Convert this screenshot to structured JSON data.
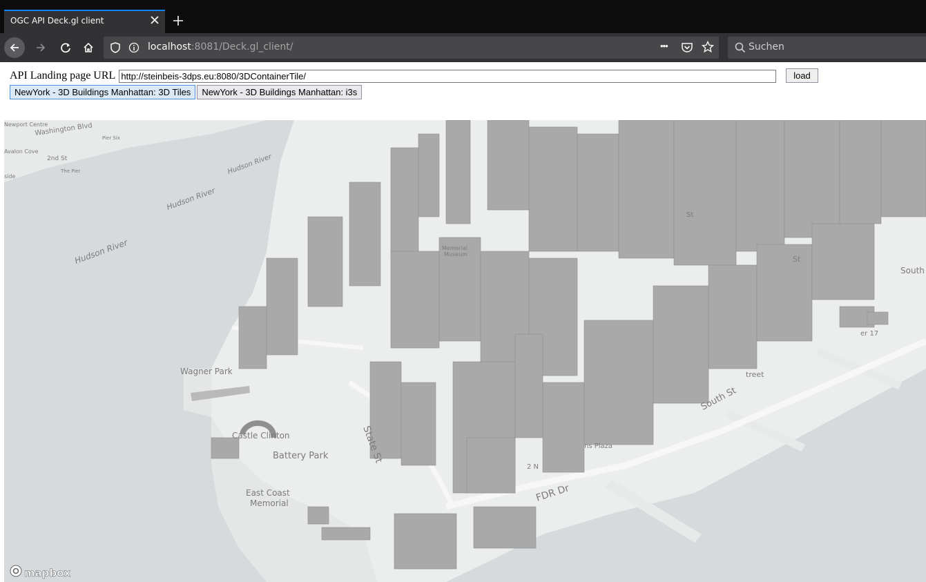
{
  "browser": {
    "tab_title": "OGC API Deck.gl client",
    "url_host": "localhost",
    "url_rest": ":8081/Deck.gl_client/",
    "search_placeholder": "Suchen",
    "page_actions": "•••"
  },
  "page": {
    "api_label": "API Landing page URL",
    "api_url_value": "http://steinbeis-3dps.eu:8080/3DContainerTile/",
    "load_label": "load",
    "datasets": [
      {
        "label": "NewYork - 3D Buildings Manhattan: 3D Tiles",
        "active": true
      },
      {
        "label": "NewYork - 3D Buildings Manhattan: i3s",
        "active": false
      }
    ]
  },
  "map": {
    "labels": {
      "newport": "Newport Centre",
      "washington": "Washington Blvd",
      "pier_six": "Pier Six",
      "avalon": "Avalon Cove",
      "second_st": "2nd St",
      "the_pier": "The Pier",
      "side": "side",
      "hudson1": "Hudson River",
      "hudson2": "Hudson River",
      "hudson3": "Hudson River",
      "wagner": "Wagner Park",
      "castle": "Castle Clinton",
      "battery": "Battery Park",
      "east_coast": "East Coast",
      "memorial": "Memorial",
      "state_st": "State St",
      "fdr": "FDR Dr",
      "south_st": "South St",
      "south": "South",
      "street": "treet",
      "pier17": "er 17",
      "st1": "St",
      "st2": "St",
      "memorial_museum": "Memorial",
      "museum": "Museum",
      "plaza": "ns Plaza",
      "two_n": "2 N"
    },
    "attribution": "mapbox",
    "colors": {
      "water": "#d6dadc",
      "land": "#eceeee",
      "building": "#a9a9a9"
    }
  }
}
